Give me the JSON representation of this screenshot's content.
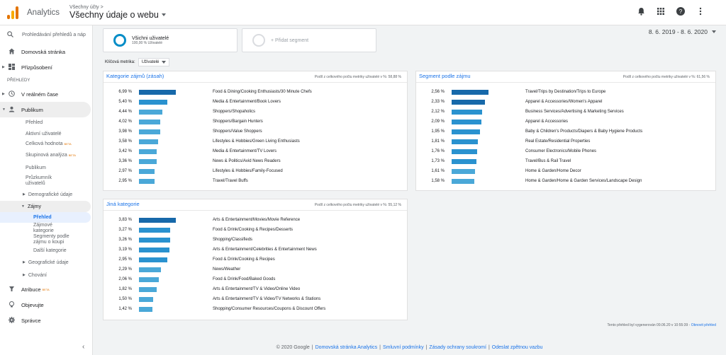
{
  "app": {
    "name": "Analytics",
    "breadcrumb": "Všechny účty >",
    "view_title": "Všechny údaje o webu"
  },
  "top_icons": [
    "bell-icon",
    "apps-grid-icon",
    "help-icon",
    "more-vert-icon"
  ],
  "sidebar": {
    "search_placeholder": "Prohledávání přehledů a náp",
    "home": "Domovská stránka",
    "customization": "Přizpůsobení",
    "reports_label": "PŘEHLEDY",
    "realtime": "V reálném čase",
    "audience": "Publikum",
    "audience_items": {
      "overview": "Přehled",
      "active_users": "Aktivní uživatelé",
      "lifetime_value": "Celková hodnota",
      "lifetime_value_beta": "BETA",
      "cohort": "Skupinová analýza",
      "cohort_beta": "BETA",
      "audiences": "Publikum",
      "user_explorer": "Průzkumník uživatelů",
      "demographics": "Demografické údaje",
      "interests": "Zájmy",
      "interests_items": {
        "overview": "Přehled",
        "affinity": "Zájmové kategorie",
        "in_market": "Segmenty podle zájmu o koupi",
        "other": "Další kategorie"
      },
      "geo": "Geografické údaje",
      "behavior": "Chování"
    },
    "attribution": "Atribuce",
    "attribution_beta": "BETA",
    "discover": "Objevujte",
    "admin": "Správce"
  },
  "segments": {
    "all_users_title": "Všichni uživatelé",
    "all_users_sub": "100,00 % Uživatelé",
    "add_segment": "+ Přidat segment"
  },
  "date_range": "8. 6. 2019 - 8. 6. 2020",
  "key_metric": {
    "label": "Klíčová metrika:",
    "value": "Uživatelé"
  },
  "panels": {
    "affinity": {
      "title": "Kategorie zájmů (zásah)",
      "share": "Podíl z celkového počtu metriky uživatelé v %: 58,88 %",
      "rows": [
        {
          "pct": "6,99 %",
          "value": 6.99,
          "label": "Food & Dining/Cooking Enthusiasts/30 Minute Chefs"
        },
        {
          "pct": "5,40 %",
          "value": 5.4,
          "label": "Media & Entertainment/Book Lovers"
        },
        {
          "pct": "4,44 %",
          "value": 4.44,
          "label": "Shoppers/Shopaholics"
        },
        {
          "pct": "4,02 %",
          "value": 4.02,
          "label": "Shoppers/Bargain Hunters"
        },
        {
          "pct": "3,98 %",
          "value": 3.98,
          "label": "Shoppers/Value Shoppers"
        },
        {
          "pct": "3,58 %",
          "value": 3.58,
          "label": "Lifestyles & Hobbies/Green Living Enthusiasts"
        },
        {
          "pct": "3,42 %",
          "value": 3.42,
          "label": "Media & Entertainment/TV Lovers"
        },
        {
          "pct": "3,36 %",
          "value": 3.36,
          "label": "News & Politics/Avid News Readers"
        },
        {
          "pct": "2,97 %",
          "value": 2.97,
          "label": "Lifestyles & Hobbies/Family-Focused"
        },
        {
          "pct": "2,95 %",
          "value": 2.95,
          "label": "Travel/Travel Buffs"
        }
      ]
    },
    "in_market": {
      "title": "Segment podle zájmu",
      "share": "Podíl z celkového počtu metriky uživatelé v %: 61,56 %",
      "rows": [
        {
          "pct": "2,56 %",
          "value": 2.56,
          "label": "Travel/Trips by Destination/Trips to Europe"
        },
        {
          "pct": "2,33 %",
          "value": 2.33,
          "label": "Apparel & Accessories/Women's Apparel"
        },
        {
          "pct": "2,12 %",
          "value": 2.12,
          "label": "Business Services/Advertising & Marketing Services"
        },
        {
          "pct": "2,09 %",
          "value": 2.09,
          "label": "Apparel & Accessories"
        },
        {
          "pct": "1,95 %",
          "value": 1.95,
          "label": "Baby & Children's Products/Diapers & Baby Hygiene Products"
        },
        {
          "pct": "1,81 %",
          "value": 1.81,
          "label": "Real Estate/Residential Properties"
        },
        {
          "pct": "1,76 %",
          "value": 1.76,
          "label": "Consumer Electronics/Mobile Phones"
        },
        {
          "pct": "1,73 %",
          "value": 1.73,
          "label": "Travel/Bus & Rail Travel"
        },
        {
          "pct": "1,61 %",
          "value": 1.61,
          "label": "Home & Garden/Home Decor"
        },
        {
          "pct": "1,58 %",
          "value": 1.58,
          "label": "Home & Garden/Home & Garden Services/Landscape Design"
        }
      ]
    },
    "other": {
      "title": "Jiná kategorie",
      "share": "Podíl z celkového počtu metriky uživatelé v %: 55,12 %",
      "rows": [
        {
          "pct": "3,83 %",
          "value": 3.83,
          "label": "Arts & Entertainment/Movies/Movie Reference"
        },
        {
          "pct": "3,27 %",
          "value": 3.27,
          "label": "Food & Drink/Cooking & Recipes/Desserts"
        },
        {
          "pct": "3,26 %",
          "value": 3.26,
          "label": "Shopping/Classifieds"
        },
        {
          "pct": "3,19 %",
          "value": 3.19,
          "label": "Arts & Entertainment/Celebrities & Entertainment News"
        },
        {
          "pct": "2,95 %",
          "value": 2.95,
          "label": "Food & Drink/Cooking & Recipes"
        },
        {
          "pct": "2,29 %",
          "value": 2.29,
          "label": "News/Weather"
        },
        {
          "pct": "2,06 %",
          "value": 2.06,
          "label": "Food & Drink/Food/Baked Goods"
        },
        {
          "pct": "1,82 %",
          "value": 1.82,
          "label": "Arts & Entertainment/TV & Video/Online Video"
        },
        {
          "pct": "1,50 %",
          "value": 1.5,
          "label": "Arts & Entertainment/TV & Video/TV Networks & Stations"
        },
        {
          "pct": "1,42 %",
          "value": 1.42,
          "label": "Shopping/Consumer Resources/Coupons & Discount Offers"
        }
      ]
    }
  },
  "report_note": {
    "text": "Tento přehled byl vygenerován 09.06.20 v 10:55:39 -",
    "link": "Obnovit přehled"
  },
  "footer": {
    "copyright": "© 2020 Google",
    "links": [
      "Domovská stránka Analytics",
      "Smluvní podmínky",
      "Zásady ochrany soukromí",
      "Odeslat zpětnou vazbu"
    ]
  },
  "colors": {
    "bar_dark": "#1769aa",
    "bar_mid": "#2a92cf",
    "bar_light": "#4aa8d8",
    "accent": "#1a73e8",
    "logo_orange": "#e37400",
    "logo_yellow": "#f9ab00"
  }
}
